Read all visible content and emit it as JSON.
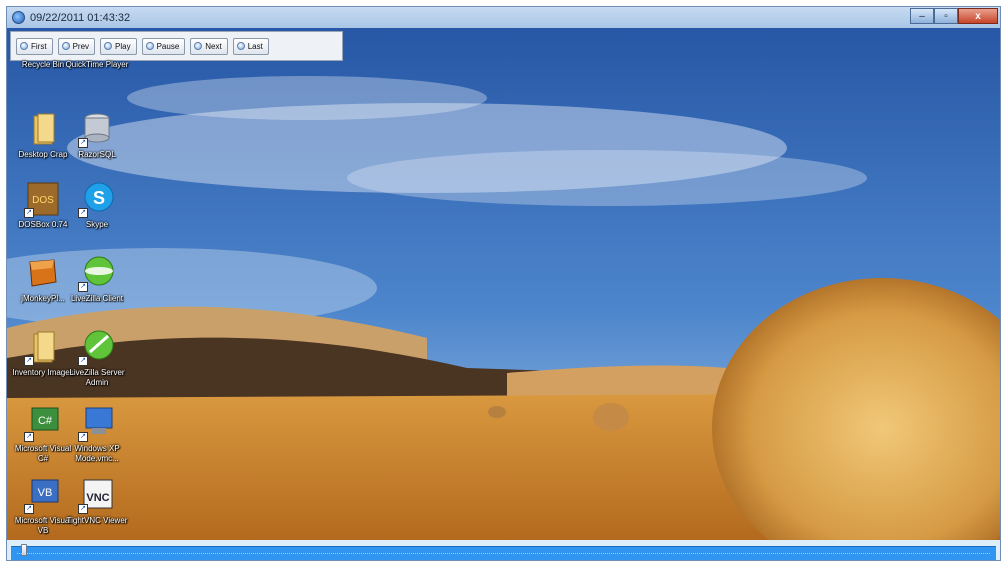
{
  "window": {
    "title": "09/22/2011 01:43:32",
    "controls": {
      "minimize": "–",
      "maximize": "▫",
      "close": "x"
    }
  },
  "toolbar": {
    "buttons": [
      {
        "label": "First",
        "icon": "first-icon"
      },
      {
        "label": "Prev",
        "icon": "prev-icon"
      },
      {
        "label": "Play",
        "icon": "play-icon"
      },
      {
        "label": "Pause",
        "icon": "pause-icon"
      },
      {
        "label": "Next",
        "icon": "next-icon"
      },
      {
        "label": "Last",
        "icon": "last-icon"
      }
    ]
  },
  "desktop": {
    "icons": [
      {
        "label": "Recycle Bin",
        "icon": "recycle-bin-icon",
        "shortcut": false
      },
      {
        "label": "QuickTime Player",
        "icon": "quicktime-icon",
        "shortcut": true
      },
      {
        "label": "Desktop Crap",
        "icon": "folder-icon",
        "shortcut": false
      },
      {
        "label": "RazorSQL",
        "icon": "database-icon",
        "shortcut": true
      },
      {
        "label": "DOSBox 0.74",
        "icon": "dosbox-icon",
        "shortcut": true
      },
      {
        "label": "Skype",
        "icon": "skype-icon",
        "shortcut": true
      },
      {
        "label": "jMonkeyPl...",
        "icon": "jmonkey-icon",
        "shortcut": false
      },
      {
        "label": "LiveZilla Client",
        "icon": "livezilla-icon",
        "shortcut": true
      },
      {
        "label": "Inventory Images",
        "icon": "folder-icon",
        "shortcut": true
      },
      {
        "label": "LiveZilla Server Admin",
        "icon": "livezilla-admin-icon",
        "shortcut": true
      },
      {
        "label": "Microsoft Visual C#",
        "icon": "visual-csharp-icon",
        "shortcut": true
      },
      {
        "label": "Windows XP Mode.vmc...",
        "icon": "xp-mode-icon",
        "shortcut": true
      },
      {
        "label": "Microsoft Visual VB",
        "icon": "visual-vb-icon",
        "shortcut": true
      },
      {
        "label": "TightVNC Viewer",
        "icon": "tightvnc-icon",
        "shortcut": true
      }
    ]
  },
  "playback": {
    "position_fraction": 0.01
  },
  "colors": {
    "accent": "#2f95f0",
    "sky": "#3f78c4",
    "field": "#c27a25"
  }
}
